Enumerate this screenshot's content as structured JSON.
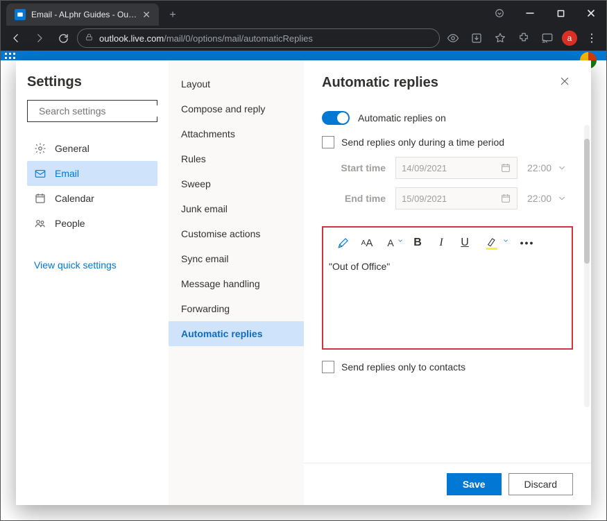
{
  "browser": {
    "tab_title": "Email - ALphr Guides - Outlook",
    "url_host": "outlook.live.com",
    "url_path": "/mail/0/options/mail/automaticReplies",
    "avatar_letter": "a"
  },
  "settings": {
    "title": "Settings",
    "search_placeholder": "Search settings",
    "categories": {
      "general": "General",
      "email": "Email",
      "calendar": "Calendar",
      "people": "People"
    },
    "quick_link": "View quick settings"
  },
  "email_nav": {
    "items": [
      "Layout",
      "Compose and reply",
      "Attachments",
      "Rules",
      "Sweep",
      "Junk email",
      "Customise actions",
      "Sync email",
      "Message handling",
      "Forwarding",
      "Automatic replies"
    ]
  },
  "panel": {
    "title": "Automatic replies",
    "toggle_label": "Automatic replies on",
    "time_period_label": "Send replies only during a time period",
    "start_label": "Start time",
    "end_label": "End time",
    "start_date": "14/09/2021",
    "end_date": "15/09/2021",
    "start_hour": "22:00",
    "end_hour": "22:00",
    "editor_text": "\"Out of Office\"",
    "contacts_only_label": "Send replies only to contacts",
    "save": "Save",
    "discard": "Discard"
  }
}
